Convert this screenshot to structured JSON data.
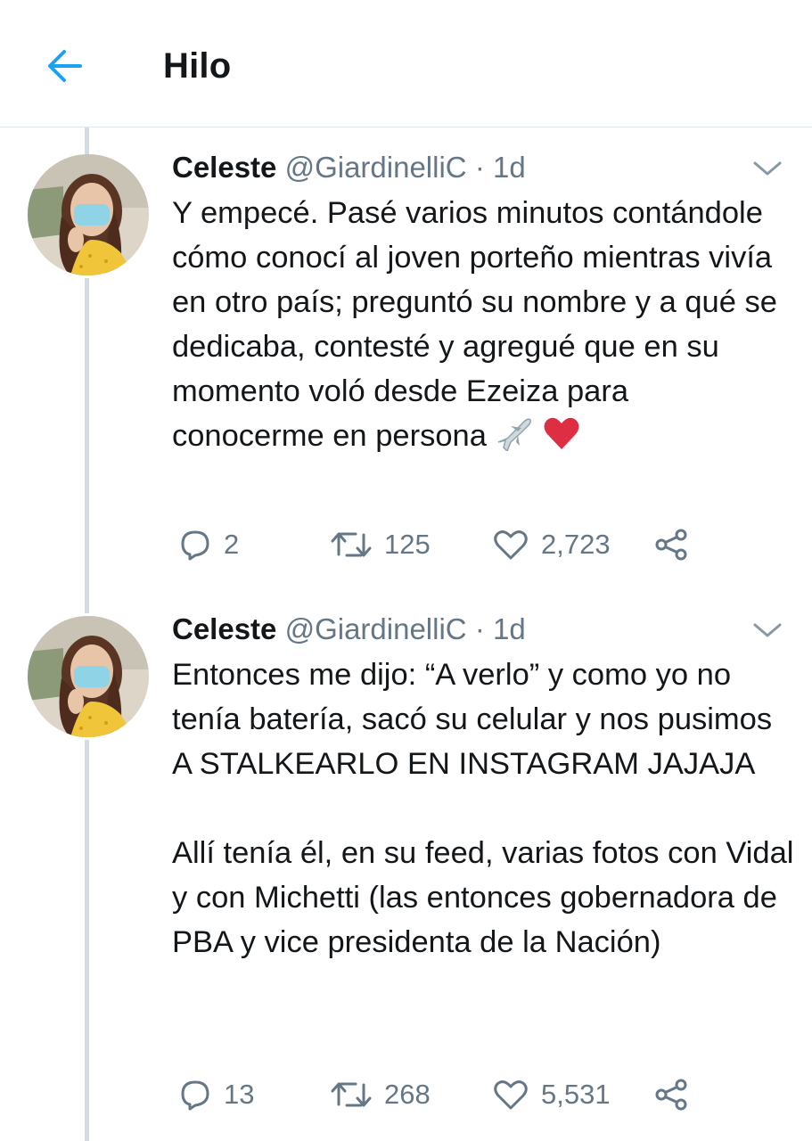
{
  "header": {
    "title": "Hilo",
    "back_icon": "arrow-left-icon",
    "accent": "#1da1f2"
  },
  "tweets": [
    {
      "name": "Celeste",
      "handle": "@GiardinelliC",
      "separator": "·",
      "time": "1d",
      "text": "Y empecé. Pasé varios minutos contándole cómo conocí al joven porteño mientras vivía en otro país; preguntó su nombre y a qué se dedicaba, contesté y agregué que en su momento voló desde Ezeiza para conocerme en persona",
      "emojis": [
        "airplane-icon",
        "red-heart-icon"
      ],
      "replies": "2",
      "retweets": "125",
      "likes": "2,723"
    },
    {
      "name": "Celeste",
      "handle": "@GiardinelliC",
      "separator": "·",
      "time": "1d",
      "text": "Entonces me dijo: “A verlo” y como yo no tenía batería, sacó su celular y nos pusimos A STALKEARLO EN INSTAGRAM JAJAJA\n\nAllí tenía él, en su feed, varias fotos con Vidal y con Michetti (las entonces gobernadora de PBA y vice presidenta de la Nación)",
      "replies": "13",
      "retweets": "268",
      "likes": "5,531"
    }
  ],
  "colors": {
    "text": "#14171a",
    "secondary": "#657786",
    "heart": "#e0245e",
    "thread_line": "#d3dce3"
  }
}
